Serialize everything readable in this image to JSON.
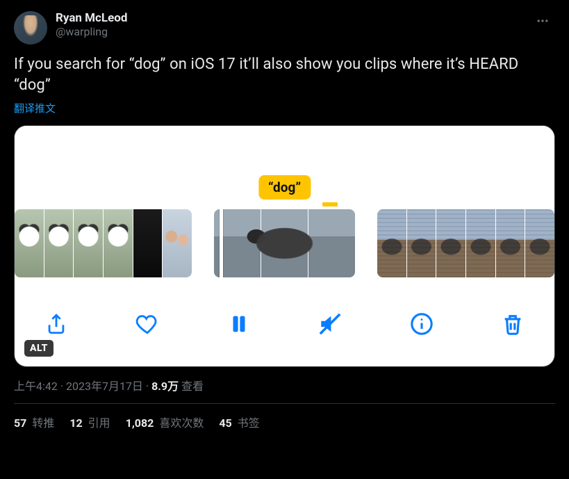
{
  "author": {
    "name": "Ryan McLeod",
    "handle": "@warpling"
  },
  "tweet_text": "If you search for “dog” on iOS 17 it’ll also show you clips where it’s HEARD “dog”",
  "translate_label": "翻译推文",
  "media": {
    "search_term_label": "“dog”",
    "alt_badge": "ALT"
  },
  "meta": {
    "time": "上午4:42",
    "separator": " · ",
    "date": "2023年7月17日",
    "views_count": "8.9万",
    "views_label": " 查看"
  },
  "stats": {
    "retweets": {
      "count": "57",
      "label": " 转推"
    },
    "quotes": {
      "count": "12",
      "label": " 引用"
    },
    "likes": {
      "count": "1,082",
      "label": " 喜欢次数"
    },
    "bookmarks": {
      "count": "45",
      "label": " 书签"
    }
  }
}
